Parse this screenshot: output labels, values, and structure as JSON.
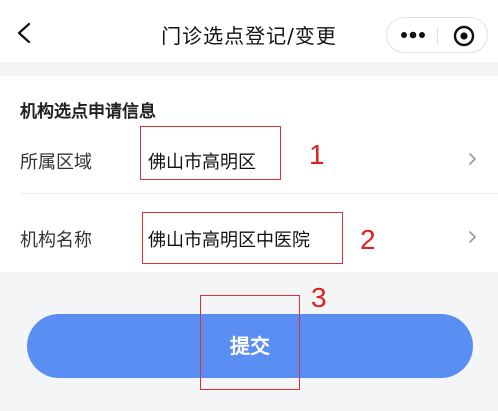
{
  "nav": {
    "title": "门诊选点登记/变更",
    "back_icon": "chevron-left-icon",
    "more_icon": "more-dots-icon",
    "close_icon": "target-circle-icon"
  },
  "form": {
    "section_title": "机构选点申请信息",
    "rows": [
      {
        "label": "所属区域",
        "value": "佛山市高明区",
        "icon": "chevron-right-icon"
      },
      {
        "label": "机构名称",
        "value": "佛山市高明区中医院",
        "icon": "chevron-right-icon"
      }
    ]
  },
  "submit_label": "提交",
  "annotations": {
    "markers": [
      "1",
      "2",
      "3"
    ],
    "color": "#e02020"
  },
  "colors": {
    "accent": "#5b8ef3",
    "background": "#f4f5f6"
  }
}
